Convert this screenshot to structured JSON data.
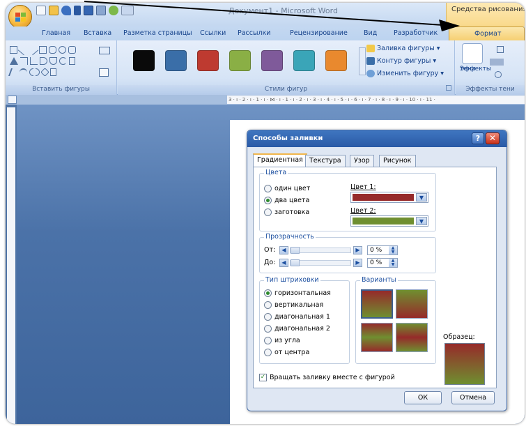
{
  "window": {
    "title": "Документ1 - Microsoft Word",
    "tools_group_label": "Средства рисования"
  },
  "tabs": [
    "Главная",
    "Вставка",
    "Разметка страницы",
    "Ссылки",
    "Рассылки",
    "Рецензирование",
    "Вид",
    "Разработчик"
  ],
  "active_tab": "Формат",
  "ribbon": {
    "insert_shapes_label": "Вставить фигуры",
    "shape_styles_label": "Стили фигур",
    "shadow_effects_label": "Эффекты тени",
    "shape_fill": "Заливка фигуры",
    "shape_outline": "Контур фигуры",
    "change_shape": "Изменить фигуру",
    "effects_button_line1": "Эффекты",
    "effects_button_line2": "тени",
    "style_colors": [
      "#0a0a0a",
      "#3a6ea8",
      "#be3a30",
      "#8aaf45",
      "#7f5a9a",
      "#3aa5b8",
      "#e9892e"
    ]
  },
  "ruler_text": "3 · ı · 2 · ı · 1 · ı · ⋈ · ı · 1 · ı · 2 · ı · 3 · ı · 4 · ı · 5 · ı · 6 · ı · 7 · ı · 8 · ı · 9 · ı · 10 · ı · 11 ·",
  "dialog": {
    "title": "Способы заливки",
    "help": "?",
    "close": "✕",
    "tabs": [
      "Градиентная",
      "Текстура",
      "Узор",
      "Рисунок"
    ],
    "colors_group": {
      "legend": "Цвета",
      "options": [
        "один цвет",
        "два цвета",
        "заготовка"
      ],
      "selected": "два цвета",
      "color1_label": "Цвет 1:",
      "color2_label": "Цвет 2:",
      "color1": "#962a2a",
      "color2": "#6f8f30"
    },
    "transparency_group": {
      "legend": "Прозрачность",
      "from_label": "От:",
      "to_label": "До:",
      "from_value": "0 %",
      "to_value": "0 %"
    },
    "hatch_group": {
      "legend": "Тип штриховки",
      "options": [
        "горизонтальная",
        "вертикальная",
        "диагональная 1",
        "диагональная 2",
        "из угла",
        "от центра"
      ],
      "selected": "горизонтальная"
    },
    "variants_label": "Варианты",
    "sample_label": "Образец:",
    "rotate_checkbox": "Вращать заливку вместе с фигурой",
    "rotate_checked": true,
    "ok": "ОК",
    "cancel": "Отмена"
  }
}
